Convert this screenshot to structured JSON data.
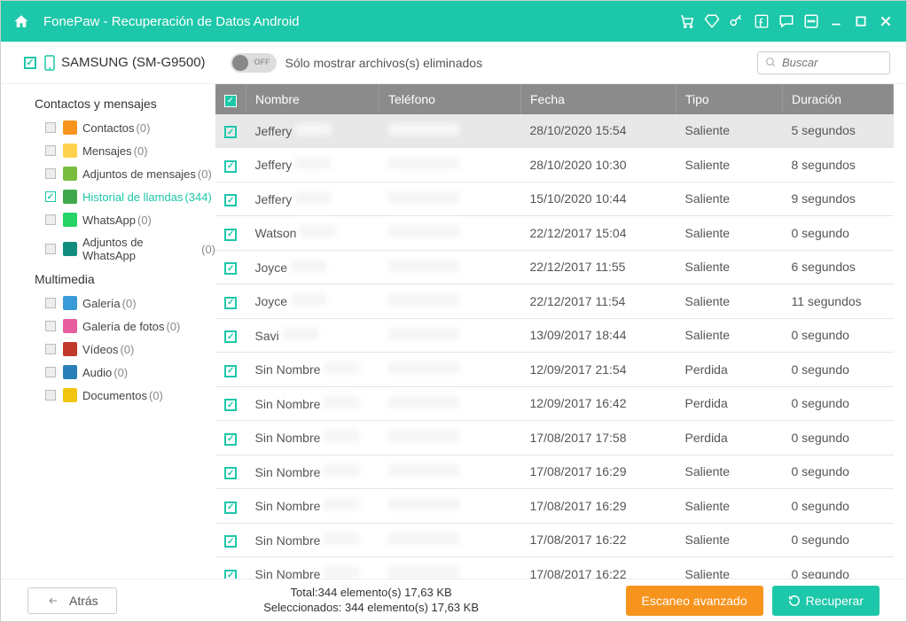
{
  "titlebar": {
    "title": "FonePaw - Recuperación de Datos Android"
  },
  "device": {
    "name": "SAMSUNG (SM-G9500)"
  },
  "toggle": {
    "state": "OFF",
    "label": "Sólo mostrar archivos(s) eliminados"
  },
  "search": {
    "placeholder": "Buscar"
  },
  "sidebar": {
    "section1_title": "Contactos y mensajes",
    "section2_title": "Multimedia",
    "items1": [
      {
        "label": "Contactos",
        "count": "(0)",
        "color": "#f7941e",
        "checked": false
      },
      {
        "label": "Mensajes",
        "count": "(0)",
        "color": "#ffd24d",
        "checked": false
      },
      {
        "label": "Adjuntos de mensajes",
        "count": "(0)",
        "color": "#7bbd3f",
        "checked": false
      },
      {
        "label": "Historial de llamdas",
        "count": "(344)",
        "color": "#3fa84c",
        "checked": true,
        "active": true
      },
      {
        "label": "WhatsApp",
        "count": "(0)",
        "color": "#25d366",
        "checked": false
      },
      {
        "label": "Adjuntos de WhatsApp",
        "count": "(0)",
        "color": "#128c7e",
        "checked": false
      }
    ],
    "items2": [
      {
        "label": "Galería",
        "count": "(0)",
        "color": "#3a9bd9",
        "checked": false
      },
      {
        "label": "Galería de fotos",
        "count": "(0)",
        "color": "#e85d9e",
        "checked": false
      },
      {
        "label": "Vídeos",
        "count": "(0)",
        "color": "#c0392b",
        "checked": false
      },
      {
        "label": "Audio",
        "count": "(0)",
        "color": "#2980b9",
        "checked": false
      },
      {
        "label": "Documentos",
        "count": "(0)",
        "color": "#f1c40f",
        "checked": false
      }
    ]
  },
  "columns": {
    "name": "Nombre",
    "phone": "Teléfono",
    "date": "Fecha",
    "type": "Tipo",
    "duration": "Duración"
  },
  "rows": [
    {
      "name": "Jeffery",
      "date": "28/10/2020 15:54",
      "type": "Saliente",
      "duration": "5 segundos",
      "selected": true
    },
    {
      "name": "Jeffery",
      "date": "28/10/2020 10:30",
      "type": "Saliente",
      "duration": "8 segundos"
    },
    {
      "name": "Jeffery",
      "date": "15/10/2020 10:44",
      "type": "Saliente",
      "duration": "9 segundos"
    },
    {
      "name": "Watson",
      "date": "22/12/2017 15:04",
      "type": "Saliente",
      "duration": "0 segundo"
    },
    {
      "name": "Joyce",
      "date": "22/12/2017 11:55",
      "type": "Saliente",
      "duration": "6 segundos"
    },
    {
      "name": "Joyce",
      "date": "22/12/2017 11:54",
      "type": "Saliente",
      "duration": "11 segundos"
    },
    {
      "name": "Savi",
      "date": "13/09/2017 18:44",
      "type": "Saliente",
      "duration": "0 segundo"
    },
    {
      "name": "Sin Nombre",
      "date": "12/09/2017 21:54",
      "type": "Perdida",
      "duration": "0 segundo"
    },
    {
      "name": "Sin Nombre",
      "date": "12/09/2017 16:42",
      "type": "Perdida",
      "duration": "0 segundo"
    },
    {
      "name": "Sin Nombre",
      "date": "17/08/2017 17:58",
      "type": "Perdida",
      "duration": "0 segundo"
    },
    {
      "name": "Sin Nombre",
      "date": "17/08/2017 16:29",
      "type": "Saliente",
      "duration": "0 segundo"
    },
    {
      "name": "Sin Nombre",
      "date": "17/08/2017 16:29",
      "type": "Saliente",
      "duration": "0 segundo"
    },
    {
      "name": "Sin Nombre",
      "date": "17/08/2017 16:22",
      "type": "Saliente",
      "duration": "0 segundo"
    },
    {
      "name": "Sin Nombre",
      "date": "17/08/2017 16:22",
      "type": "Saliente",
      "duration": "0 segundo"
    }
  ],
  "footer": {
    "back": "Atrás",
    "total": "Total:344 elemento(s) 17,63 KB",
    "selected": "Seleccionados: 344 elemento(s) 17,63 KB",
    "scan": "Escaneo avanzado",
    "recover": "Recuperar"
  }
}
